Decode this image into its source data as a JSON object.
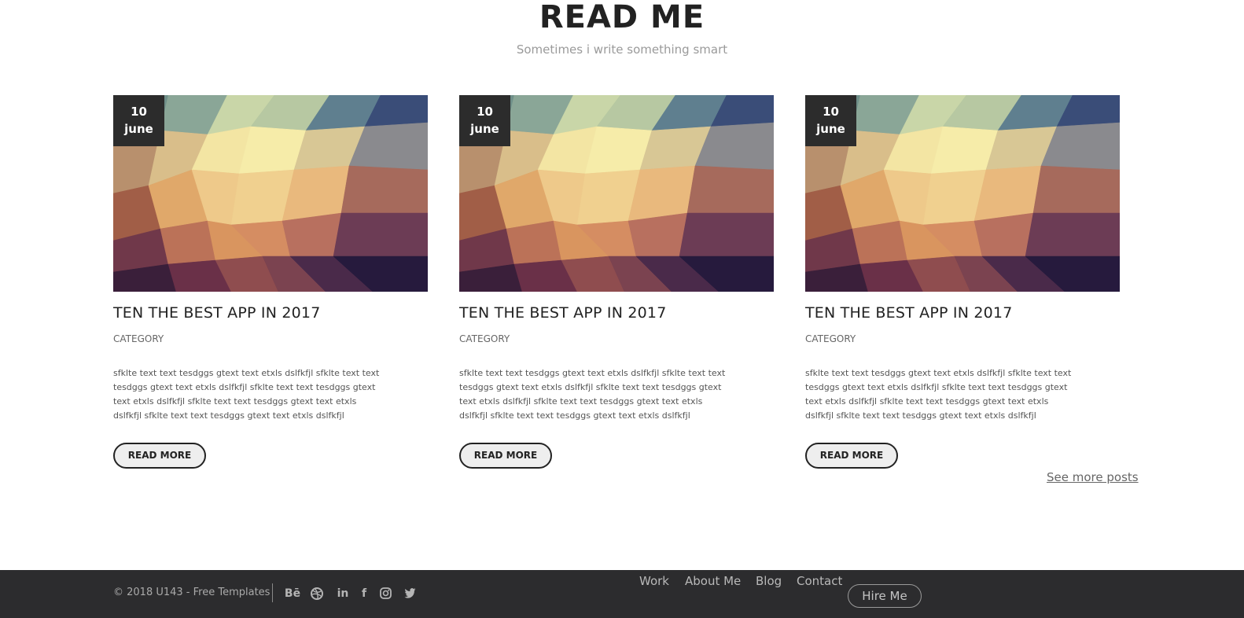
{
  "header": {
    "title": "READ ME",
    "subtitle": "Sometimes i write something smart"
  },
  "posts": [
    {
      "day": "10",
      "month": "june",
      "title": "TEN THE BEST APP IN 2017",
      "category": "CATEGORY",
      "excerpt": "sfklte text text tesdggs gtext text etxls dslfkfjl sfklte text text tesdggs gtext text etxls dslfkfjl sfklte text text tesdggs gtext text etxls dslfkfjl sfklte text text tesdggs gtext text etxls dslfkfjl sfklte text text tesdggs gtext text etxls dslfkfjl",
      "button_label": "READ MORE"
    },
    {
      "day": "10",
      "month": "june",
      "title": "TEN THE BEST APP IN 2017",
      "category": "CATEGORY",
      "excerpt": "sfklte text text tesdggs gtext text etxls dslfkfjl sfklte text text tesdggs gtext text etxls dslfkfjl sfklte text text tesdggs gtext text etxls dslfkfjl sfklte text text tesdggs gtext text etxls dslfkfjl sfklte text text tesdggs gtext text etxls dslfkfjl",
      "button_label": "READ MORE"
    },
    {
      "day": "10",
      "month": "june",
      "title": "TEN THE BEST APP IN 2017",
      "category": "CATEGORY",
      "excerpt": "sfklte text text tesdggs gtext text etxls dslfkfjl sfklte text text tesdggs gtext text etxls dslfkfjl sfklte text text tesdggs gtext text etxls dslfkfjl sfklte text text tesdggs gtext text etxls dslfkfjl sfklte text text tesdggs gtext text etxls dslfkfjl",
      "button_label": "READ MORE"
    }
  ],
  "see_more_label": "See more posts",
  "footer": {
    "copyright": "© 2018 U143 - Free Templates",
    "socials": [
      {
        "icon": "behance-icon",
        "glyph": "Bē"
      },
      {
        "icon": "dribbble-icon"
      },
      {
        "icon": "linkedin-icon",
        "glyph": "in"
      },
      {
        "icon": "facebook-icon",
        "glyph": "f"
      },
      {
        "icon": "instagram-icon"
      },
      {
        "icon": "twitter-icon"
      }
    ],
    "nav": [
      "Work",
      "About Me",
      "Blog",
      "Contact"
    ],
    "hire_label": "Hire Me"
  },
  "colors": {
    "footer_bg": "#2c2c2e",
    "badge_bg": "#2c2c2c",
    "button_bg": "#eeeeee"
  }
}
